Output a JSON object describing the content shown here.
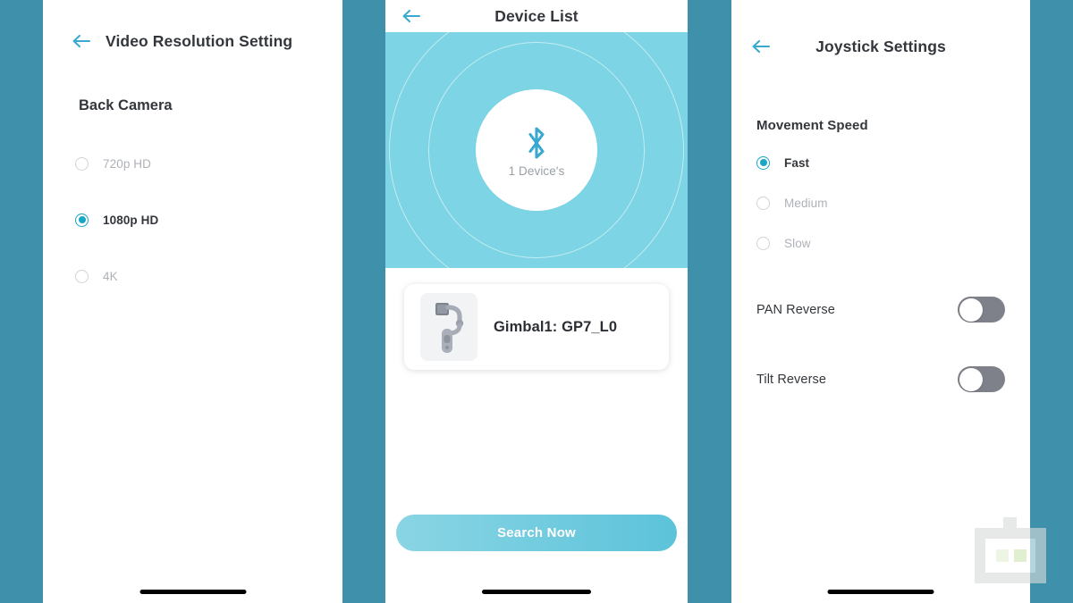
{
  "background_color": "#3e90ab",
  "accent_color": "#1aa6c4",
  "splash_color": "#7cd4e4",
  "screens": {
    "video_resolution": {
      "back_icon": "arrow-left-icon",
      "title": "Video Resolution Setting",
      "section_title": "Back Camera",
      "options": [
        {
          "label": "720p HD",
          "selected": false
        },
        {
          "label": "1080p HD",
          "selected": true
        },
        {
          "label": "4K",
          "selected": false
        }
      ]
    },
    "device_list": {
      "back_icon": "arrow-left-icon",
      "title": "Device List",
      "splash": {
        "bluetooth_icon": "bluetooth-icon",
        "device_count_text": "1 Device's"
      },
      "devices": [
        {
          "thumb_icon": "gimbal-icon",
          "name": "Gimbal1: GP7_L0"
        }
      ],
      "search_button_label": "Search Now"
    },
    "joystick_settings": {
      "back_icon": "arrow-left-icon",
      "title": "Joystick Settings",
      "section_title": "Movement Speed",
      "speed_options": [
        {
          "label": "Fast",
          "selected": true
        },
        {
          "label": "Medium",
          "selected": false
        },
        {
          "label": "Slow",
          "selected": false
        }
      ],
      "toggles": [
        {
          "label": "PAN Reverse",
          "on": false
        },
        {
          "label": "Tilt Reverse",
          "on": false
        }
      ]
    }
  },
  "watermark": {
    "icon": "robot-logo-icon"
  }
}
